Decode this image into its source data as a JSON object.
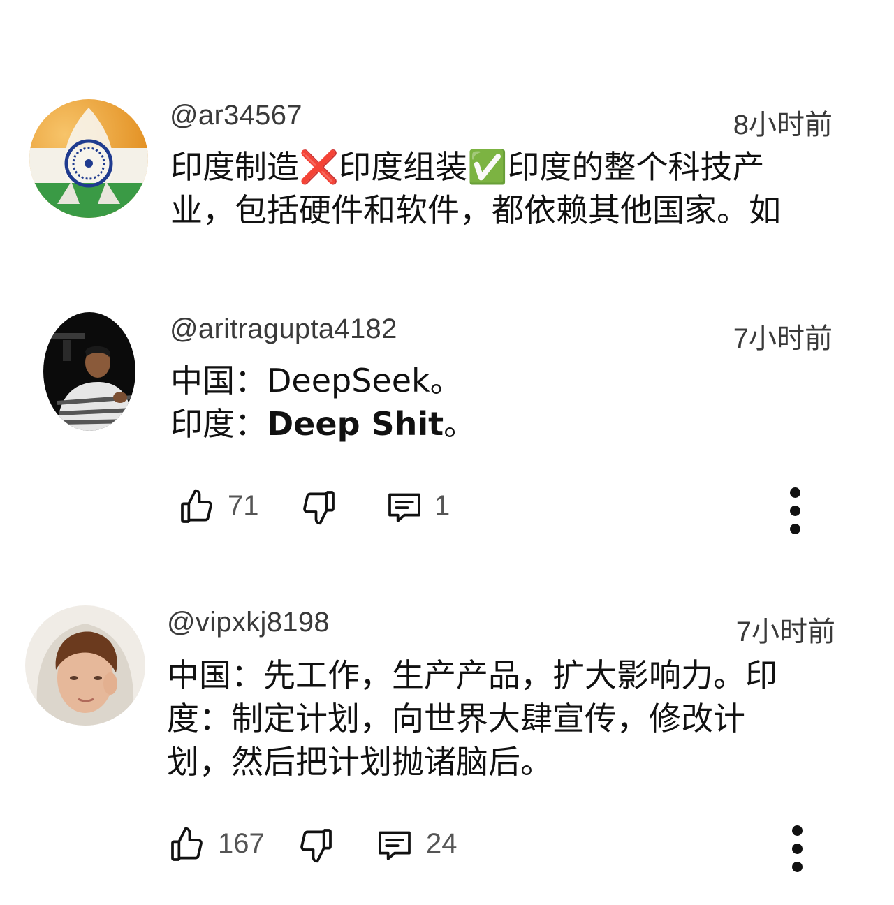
{
  "comments": [
    {
      "handle": "@ar34567",
      "time": "8小时前",
      "lines": [
        "印度制造❌印度组装✅印度的整个科技产",
        "业，包括硬件和软件，都依赖其他国家。如"
      ]
    },
    {
      "handle": "@aritragupta4182",
      "time": "7小时前",
      "line1_prefix": "中国：",
      "line1_main": "DeepSeek",
      "line1_suffix": "。",
      "line2_prefix": "印度：",
      "line2_main": "Deep Shit",
      "line2_suffix": "。",
      "likes": "71",
      "replies": "1"
    },
    {
      "handle": "@vipxkj8198",
      "time": "7小时前",
      "lines": [
        "中国：先工作，生产产品，扩大影响力。印",
        "度：制定计划，向世界大肆宣传，修改计",
        "划，然后把计划抛诸脑后。"
      ],
      "likes": "167",
      "replies": "24"
    }
  ],
  "icons": {
    "like": "thumbs-up-icon",
    "dislike": "thumbs-down-icon",
    "reply": "comment-icon",
    "more": "more-vertical-icon"
  },
  "colors": {
    "text": "#0f0f0f",
    "secondary": "#555555",
    "flag_saffron": "#f29a1f",
    "flag_green": "#2e8b3d",
    "chakra_blue": "#1f3b8f"
  }
}
